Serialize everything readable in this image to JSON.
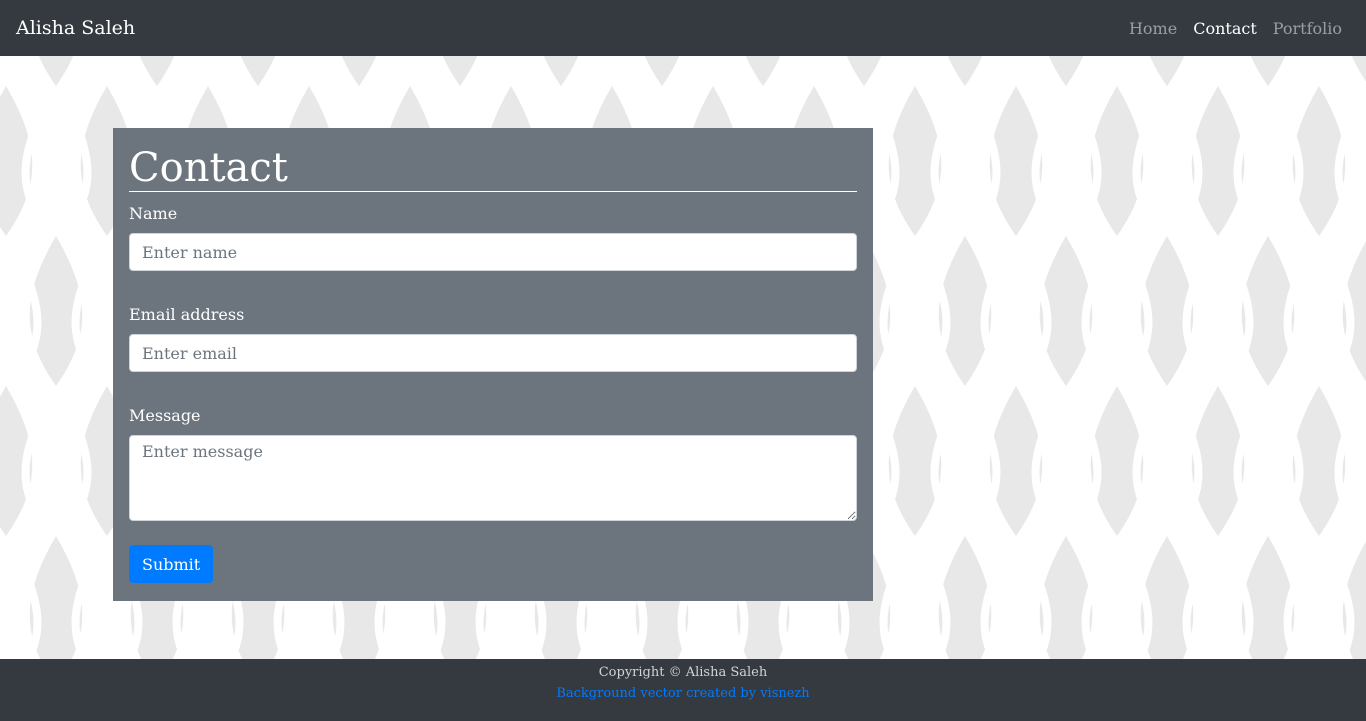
{
  "navbar": {
    "brand": "Alisha Saleh",
    "links": [
      {
        "label": "Home",
        "active": false
      },
      {
        "label": "Contact",
        "active": true
      },
      {
        "label": "Portfolio",
        "active": false
      }
    ]
  },
  "contact": {
    "title": "Contact",
    "name_label": "Name",
    "name_placeholder": "Enter name",
    "email_label": "Email address",
    "email_placeholder": "Enter email",
    "message_label": "Message",
    "message_placeholder": "Enter message",
    "submit_label": "Submit"
  },
  "footer": {
    "copyright": "Copyright © Alisha Saleh",
    "credit": "Background vector created by visnezh"
  },
  "colors": {
    "navbar_bg": "#343a40",
    "panel_bg": "#6c757d",
    "pattern": "#e9e9e9",
    "accent": "#007bff"
  }
}
